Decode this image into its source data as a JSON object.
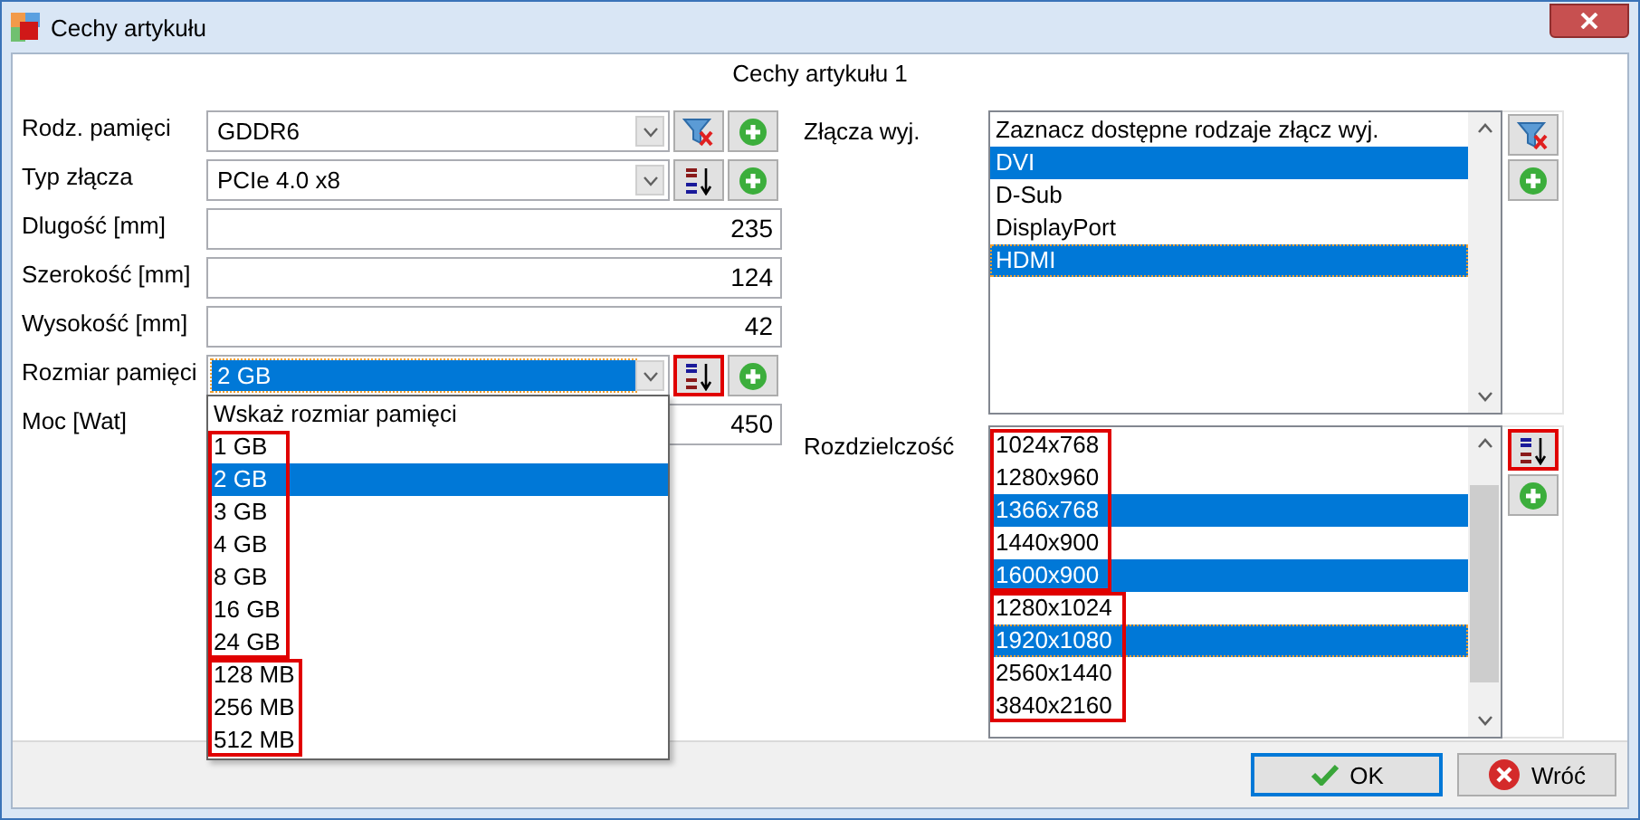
{
  "window": {
    "title": "Cechy artykułu"
  },
  "heading": "Cechy artykułu 1",
  "fields": [
    {
      "kind": "combo",
      "label": "Rodz. pamięci",
      "value": "GDDR6",
      "focused": false,
      "buttons": [
        {
          "kind": "filter",
          "framed": false
        },
        {
          "kind": "add",
          "framed": false
        }
      ]
    },
    {
      "kind": "combo",
      "label": "Typ złącza",
      "value": "PCIe 4.0 x8",
      "focused": false,
      "buttons": [
        {
          "kind": "sort-desc",
          "framed": false
        },
        {
          "kind": "add",
          "framed": false
        }
      ]
    },
    {
      "kind": "text",
      "label": "Dlugość [mm]",
      "value": "235"
    },
    {
      "kind": "text",
      "label": "Szerokość [mm]",
      "value": "124"
    },
    {
      "kind": "text",
      "label": "Wysokość [mm]",
      "value": "42"
    },
    {
      "kind": "combo",
      "label": "Rozmiar pamięci",
      "value": "2 GB",
      "focused": true,
      "buttons": [
        {
          "kind": "sort-asc",
          "framed": true
        },
        {
          "kind": "add",
          "framed": false
        }
      ]
    },
    {
      "kind": "text",
      "label": "Moc [Wat]",
      "value": "450"
    }
  ],
  "dropdown": {
    "prompt": "Wskaż rozmiar pamięci",
    "groups": [
      {
        "framed": true,
        "items": [
          {
            "label": "1 GB",
            "selected": false
          },
          {
            "label": "2 GB",
            "selected": true
          },
          {
            "label": "3 GB",
            "selected": false
          },
          {
            "label": "4 GB",
            "selected": false
          },
          {
            "label": "8 GB",
            "selected": false
          },
          {
            "label": "16 GB",
            "selected": false
          },
          {
            "label": "24 GB",
            "selected": false
          }
        ]
      },
      {
        "framed": true,
        "items": [
          {
            "label": "128 MB",
            "selected": false
          },
          {
            "label": "256 MB",
            "selected": false
          },
          {
            "label": "512 MB",
            "selected": false
          }
        ]
      }
    ]
  },
  "connectors": {
    "label": "Złącza wyj.",
    "groups": [
      {
        "framed": false,
        "items": [
          {
            "label": "Zaznacz dostępne rodzaje złącz wyj.",
            "selected": false,
            "focused": false
          },
          {
            "label": "DVI",
            "selected": true,
            "focused": false
          },
          {
            "label": "D-Sub",
            "selected": false,
            "focused": false
          },
          {
            "label": "DisplayPort",
            "selected": false,
            "focused": false
          },
          {
            "label": "HDMI",
            "selected": true,
            "focused": true
          }
        ]
      }
    ],
    "buttons": [
      {
        "kind": "filter",
        "framed": false
      },
      {
        "kind": "add",
        "framed": false
      }
    ]
  },
  "resolution": {
    "label": "Rozdzielczość",
    "groups": [
      {
        "framed": true,
        "items": [
          {
            "label": "1024x768",
            "selected": false,
            "focused": false
          },
          {
            "label": "1280x960",
            "selected": false,
            "focused": false
          },
          {
            "label": "1366x768",
            "selected": true,
            "focused": false
          },
          {
            "label": "1440x900",
            "selected": false,
            "focused": false
          },
          {
            "label": "1600x900",
            "selected": true,
            "focused": false
          }
        ]
      },
      {
        "framed": true,
        "items": [
          {
            "label": "1280x1024",
            "selected": false,
            "focused": false
          },
          {
            "label": "1920x1080",
            "selected": true,
            "focused": true
          },
          {
            "label": "2560x1440",
            "selected": false,
            "focused": false
          },
          {
            "label": "3840x2160",
            "selected": false,
            "focused": false
          }
        ]
      }
    ],
    "buttons": [
      {
        "kind": "sort-asc",
        "framed": true
      },
      {
        "kind": "add",
        "framed": false
      }
    ]
  },
  "buttons": [
    {
      "kind": "ok",
      "label": "OK",
      "default": true
    },
    {
      "kind": "cancel",
      "label": "Wróć",
      "default": false
    }
  ]
}
